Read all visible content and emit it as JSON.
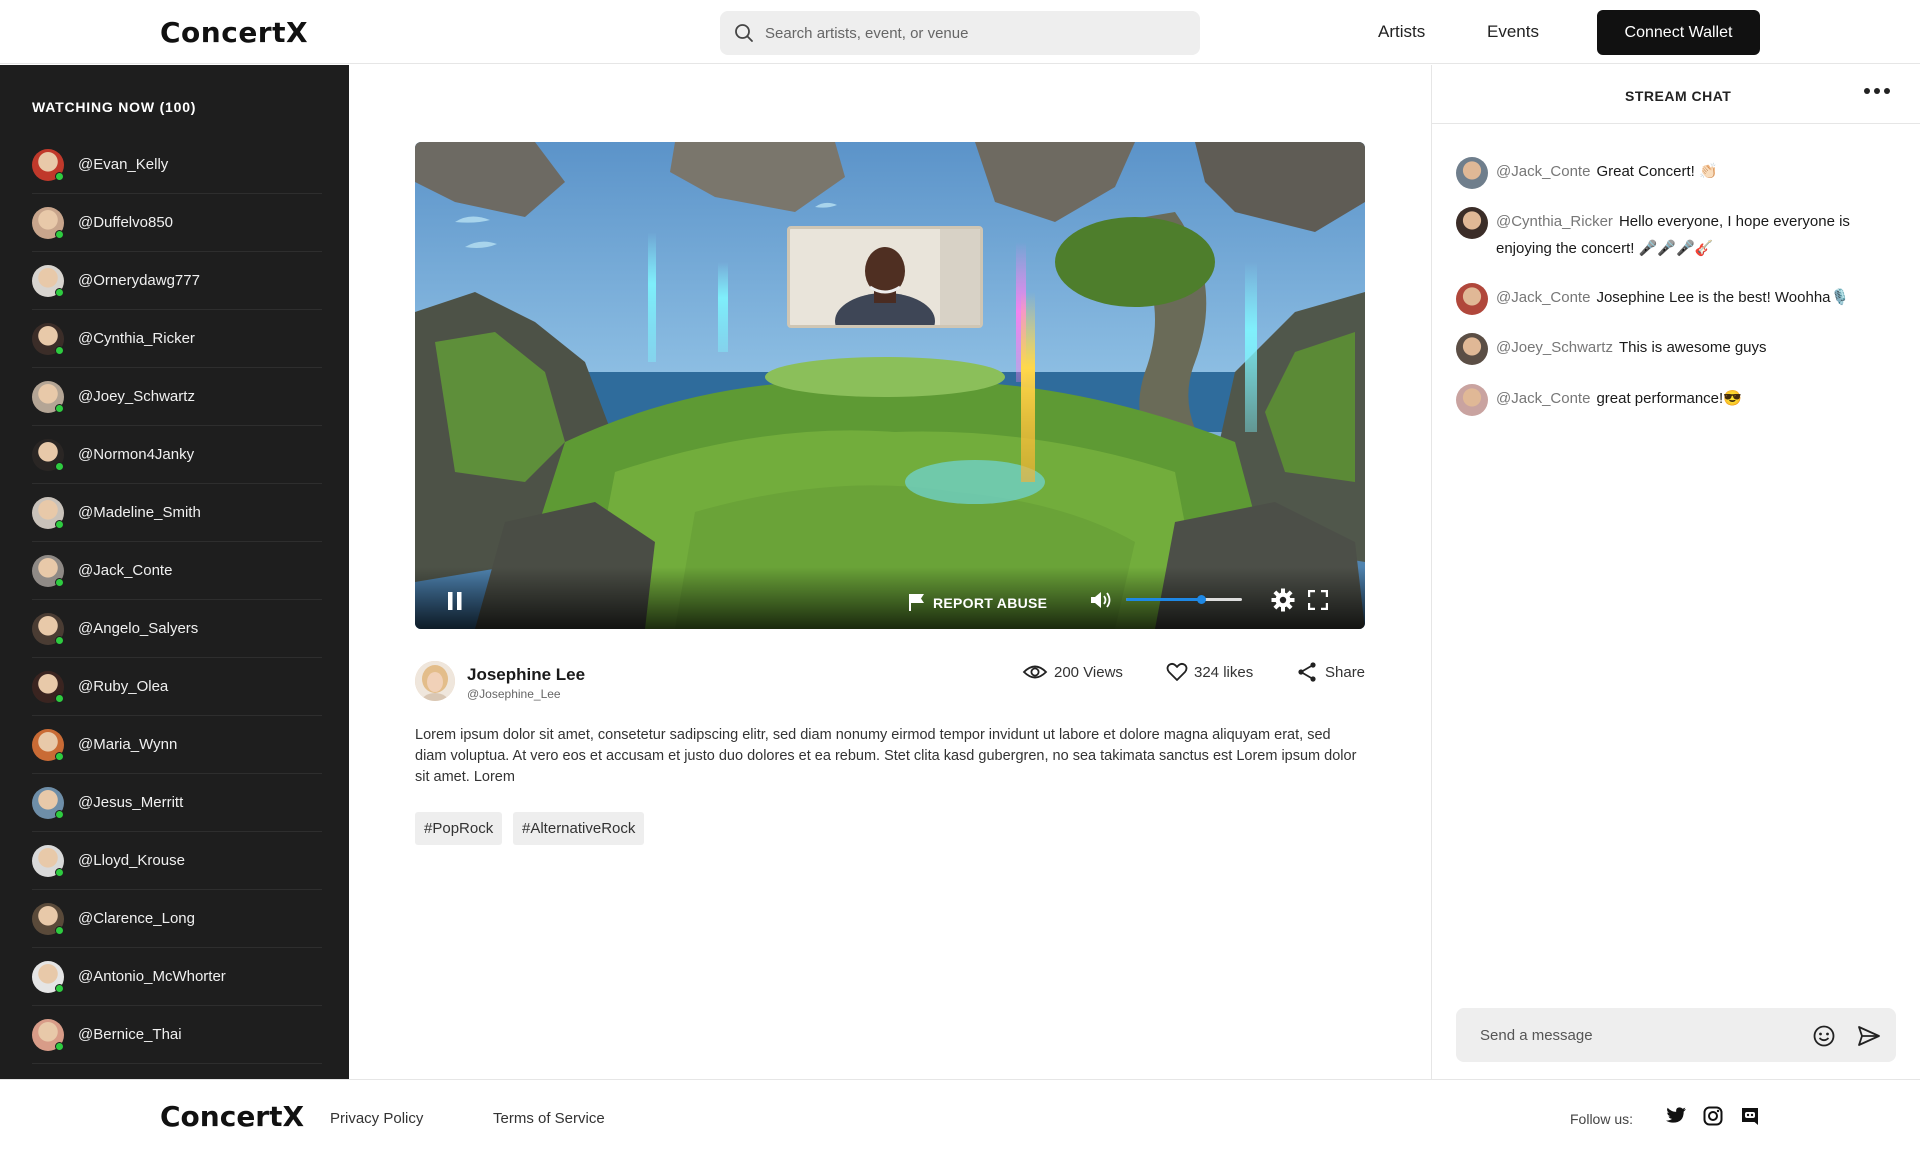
{
  "header": {
    "logo": "ConcertX",
    "search_placeholder": "Search artists, event, or venue",
    "nav": [
      "Artists",
      "Events"
    ],
    "wallet_button": "Connect Wallet"
  },
  "sidebar": {
    "title": "WATCHING NOW (100)",
    "viewers": [
      {
        "name": "@Evan_Kelly",
        "color": "#c0392b"
      },
      {
        "name": "@Duffelvo850",
        "color": "#c8a58c"
      },
      {
        "name": "@Ornerydawg777",
        "color": "#d8d4cf"
      },
      {
        "name": "@Cynthia_Ricker",
        "color": "#3b2d28"
      },
      {
        "name": "@Joey_Schwartz",
        "color": "#b4a595"
      },
      {
        "name": "@Normon4Janky",
        "color": "#2a2624"
      },
      {
        "name": "@Madeline_Smith",
        "color": "#c9c2ba"
      },
      {
        "name": "@Jack_Conte",
        "color": "#8f8a86"
      },
      {
        "name": "@Angelo_Salyers",
        "color": "#4a3c33"
      },
      {
        "name": "@Ruby_Olea",
        "color": "#3a2420"
      },
      {
        "name": "@Maria_Wynn",
        "color": "#c96b35"
      },
      {
        "name": "@Jesus_Merritt",
        "color": "#6e8ea8"
      },
      {
        "name": "@Lloyd_Krouse",
        "color": "#d9d9d9"
      },
      {
        "name": "@Clarence_Long",
        "color": "#5a4a3a"
      },
      {
        "name": "@Antonio_McWhorter",
        "color": "#e5e5e5"
      },
      {
        "name": "@Bernice_Thai",
        "color": "#d89c88"
      }
    ]
  },
  "player": {
    "report_label": "REPORT ABUSE",
    "volume_level": 0.65
  },
  "stream": {
    "artist_name": "Josephine Lee",
    "artist_handle": "@Josephine_Lee",
    "views": "200 Views",
    "likes": "324 likes",
    "share": "Share",
    "description": "Lorem ipsum dolor sit amet, consetetur sadipscing elitr, sed diam nonumy eirmod tempor invidunt ut labore et dolore magna aliquyam erat, sed diam voluptua. At vero eos et accusam et justo duo dolores et ea rebum. Stet clita kasd gubergren, no sea takimata sanctus est Lorem ipsum dolor sit amet. Lorem",
    "tags": [
      "#PopRock",
      "#AlternativeRock"
    ]
  },
  "chat": {
    "title": "STREAM CHAT",
    "messages": [
      {
        "user": "@Jack_Conte",
        "text": "Great Concert! 👏🏻",
        "color": "#6f7e8c"
      },
      {
        "user": "@Cynthia_Ricker",
        "text": "Hello everyone, I hope everyone is enjoying the concert! 🎤🎤🎤🎸",
        "color": "#3b2d28"
      },
      {
        "user": "@Jack_Conte",
        "text": "Josephine Lee is the best! Woohha🎙️",
        "color": "#b0473b"
      },
      {
        "user": "@Joey_Schwartz",
        "text": "This is awesome guys",
        "color": "#5b4e45"
      },
      {
        "user": "@Jack_Conte",
        "text": "great performance!😎",
        "color": "#c9a3a0"
      }
    ],
    "input_placeholder": "Send a message"
  },
  "footer": {
    "logo": "ConcertX",
    "links": [
      "Privacy Policy",
      "Terms of Service"
    ],
    "follow_label": "Follow us:",
    "socials": [
      "twitter-icon",
      "instagram-icon",
      "discord-icon"
    ]
  }
}
